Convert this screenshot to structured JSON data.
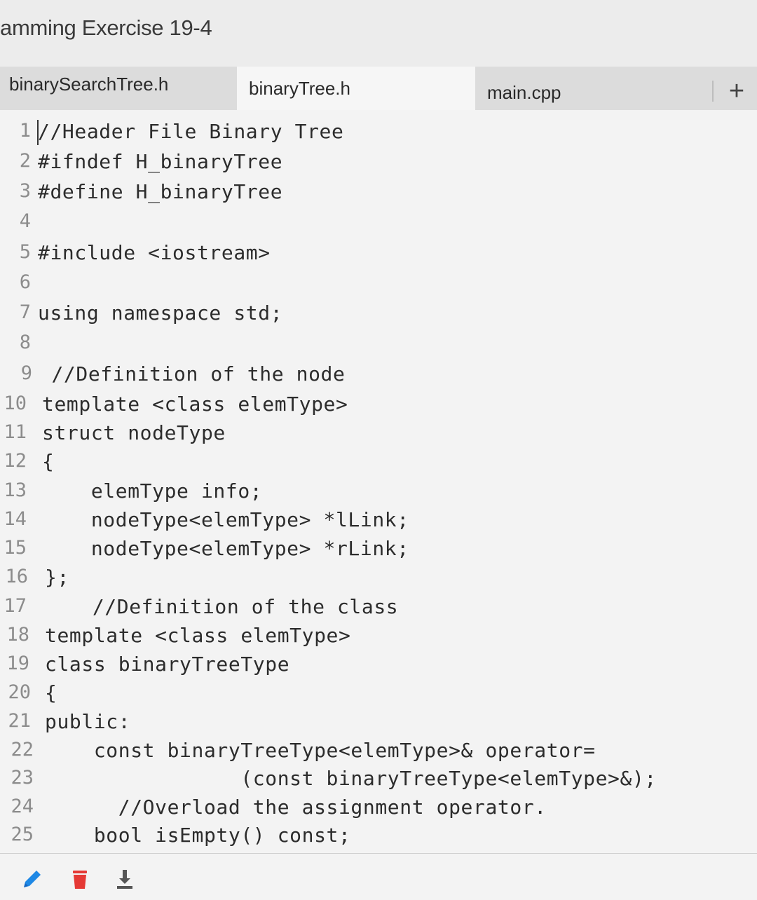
{
  "header": {
    "title": "amming Exercise 19-4"
  },
  "tabs": [
    {
      "label": "binarySearchTree.h"
    },
    {
      "label": "binaryTree.h"
    },
    {
      "label": "main.cpp"
    }
  ],
  "add_tab_label": "+",
  "editor": {
    "lines": [
      {
        "num": "1",
        "code": "//Header File Binary Tree"
      },
      {
        "num": "2",
        "code": "#ifndef H_binaryTree"
      },
      {
        "num": "3",
        "code": "#define H_binaryTree"
      },
      {
        "num": "4",
        "code": ""
      },
      {
        "num": "5",
        "code": "#include <iostream>"
      },
      {
        "num": "6",
        "code": ""
      },
      {
        "num": "7",
        "code": "using namespace std;"
      },
      {
        "num": "8",
        "code": ""
      },
      {
        "num": "9",
        "code": " //Definition of the node"
      },
      {
        "num": "10",
        "code": "template <class elemType>"
      },
      {
        "num": "11",
        "code": "struct nodeType"
      },
      {
        "num": "12",
        "code": "{"
      },
      {
        "num": "13",
        "code": "    elemType info;"
      },
      {
        "num": "14",
        "code": "    nodeType<elemType> *lLink;"
      },
      {
        "num": "15",
        "code": "    nodeType<elemType> *rLink;"
      },
      {
        "num": "16",
        "code": "};"
      },
      {
        "num": "17",
        "code": "    //Definition of the class"
      },
      {
        "num": "18",
        "code": "template <class elemType>"
      },
      {
        "num": "19",
        "code": "class binaryTreeType"
      },
      {
        "num": "20",
        "code": "{"
      },
      {
        "num": "21",
        "code": "public:"
      },
      {
        "num": "22",
        "code": "    const binaryTreeType<elemType>& operator="
      },
      {
        "num": "23",
        "code": "                (const binaryTreeType<elemType>&);"
      },
      {
        "num": "24",
        "code": "      //Overload the assignment operator."
      },
      {
        "num": "25",
        "code": "    bool isEmpty() const;"
      }
    ]
  },
  "toolbar": {
    "icons": [
      "pencil-icon",
      "trash-icon",
      "download-icon"
    ],
    "colors": {
      "edit": "#1e88e5",
      "delete": "#e53935",
      "download": "#555555"
    }
  }
}
